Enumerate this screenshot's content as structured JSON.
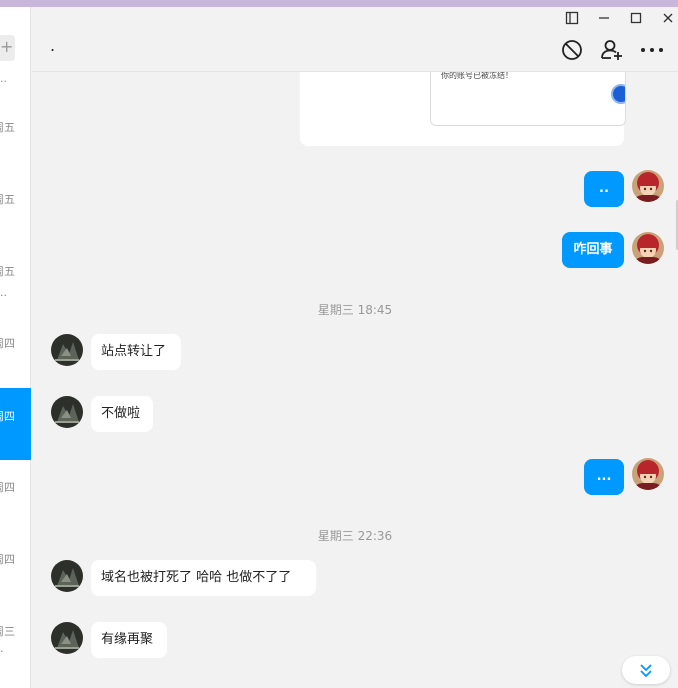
{
  "window": {
    "title": "."
  },
  "sidebar": {
    "items": [
      {
        "label": "周五",
        "dots": "..",
        "active": false
      },
      {
        "label": "周五",
        "dots": "",
        "active": false
      },
      {
        "label": "周五",
        "dots": "..",
        "active": false
      },
      {
        "label": "周四",
        "dots": "",
        "active": false
      },
      {
        "label": "周四",
        "dots": "",
        "active": true
      },
      {
        "label": "周四",
        "dots": "",
        "active": false
      },
      {
        "label": "周四",
        "dots": "",
        "active": false
      },
      {
        "label": "周三",
        "dots": ".",
        "active": false
      }
    ]
  },
  "card": {
    "text": "你的账号已被冻结！"
  },
  "messages": {
    "m1": {
      "text": ".."
    },
    "m2": {
      "text": "咋回事"
    },
    "ts1": "星期三 18:45",
    "m3": {
      "text": "站点转让了"
    },
    "m4": {
      "text": "不做啦"
    },
    "m5": {
      "text": "..."
    },
    "ts2": "星期三 22:36",
    "m6": {
      "text": "域名也被打死了 哈哈 也做不了了"
    },
    "m7": {
      "text": "有缘再聚"
    }
  },
  "colors": {
    "accent": "#0099ff",
    "background": "#f2f2f2"
  },
  "icons": [
    "sidebar-toggle-icon",
    "minimize-icon",
    "maximize-icon",
    "close-icon",
    "block-icon",
    "add-user-icon",
    "more-icon",
    "chevron-double-down-icon"
  ]
}
